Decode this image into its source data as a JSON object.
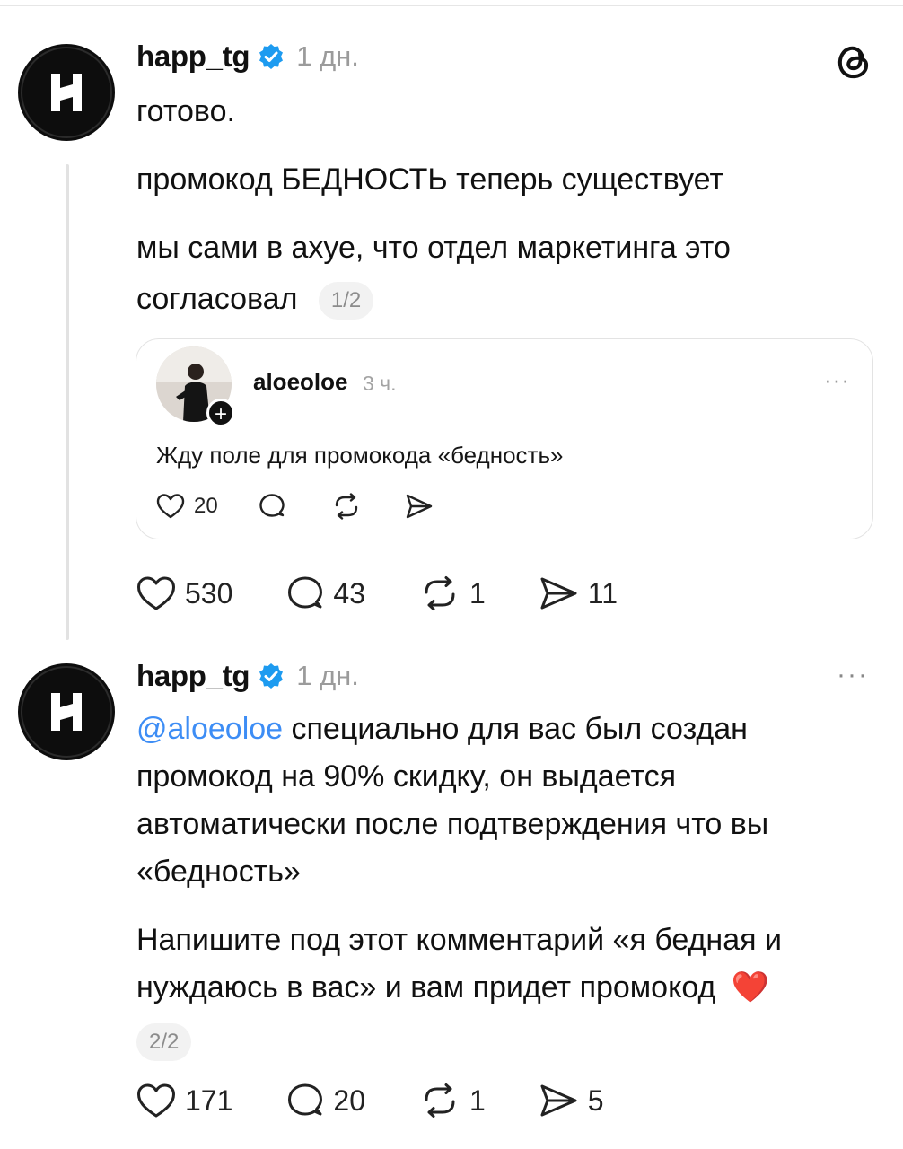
{
  "post1": {
    "username": "happ_tg",
    "time": "1 дн.",
    "lines": [
      "готово.",
      "промокод БЕДНОСТЬ теперь существует",
      "мы сами в ахуе, что отдел маркетинга это",
      "согласовал"
    ],
    "pager": "1/2",
    "likes": "530",
    "comments": "43",
    "reposts": "1",
    "shares": "11"
  },
  "quote": {
    "username": "aloeoloe",
    "time": "3 ч.",
    "text": "Жду поле для промокода «бедность»",
    "likes": "20",
    "follow": "+",
    "more": "···"
  },
  "post2": {
    "username": "happ_tg",
    "time": "1 дн.",
    "mention": "@aloeoloe",
    "line1_rest": " специально для вас был создан",
    "lines": [
      "промокод на 90% скидку, он выдается",
      "автоматически после подтверждения что вы",
      "«бедность»",
      "Напишите под этот комментарий «я бедная и",
      "нуждаюсь в вас» и вам придет промокод"
    ],
    "emoji": "❤️",
    "pager": "2/2",
    "likes": "171",
    "comments": "20",
    "reposts": "1",
    "shares": "5",
    "more": "···"
  },
  "colors": {
    "mention": "#3d8df5",
    "verified": "#1d9bf0",
    "muted": "#9b9b9b"
  },
  "icons": [
    "threads-logo-icon",
    "verified-badge-icon",
    "heart-icon",
    "comment-icon",
    "repost-icon",
    "share-icon",
    "more-icon",
    "plus-icon"
  ]
}
